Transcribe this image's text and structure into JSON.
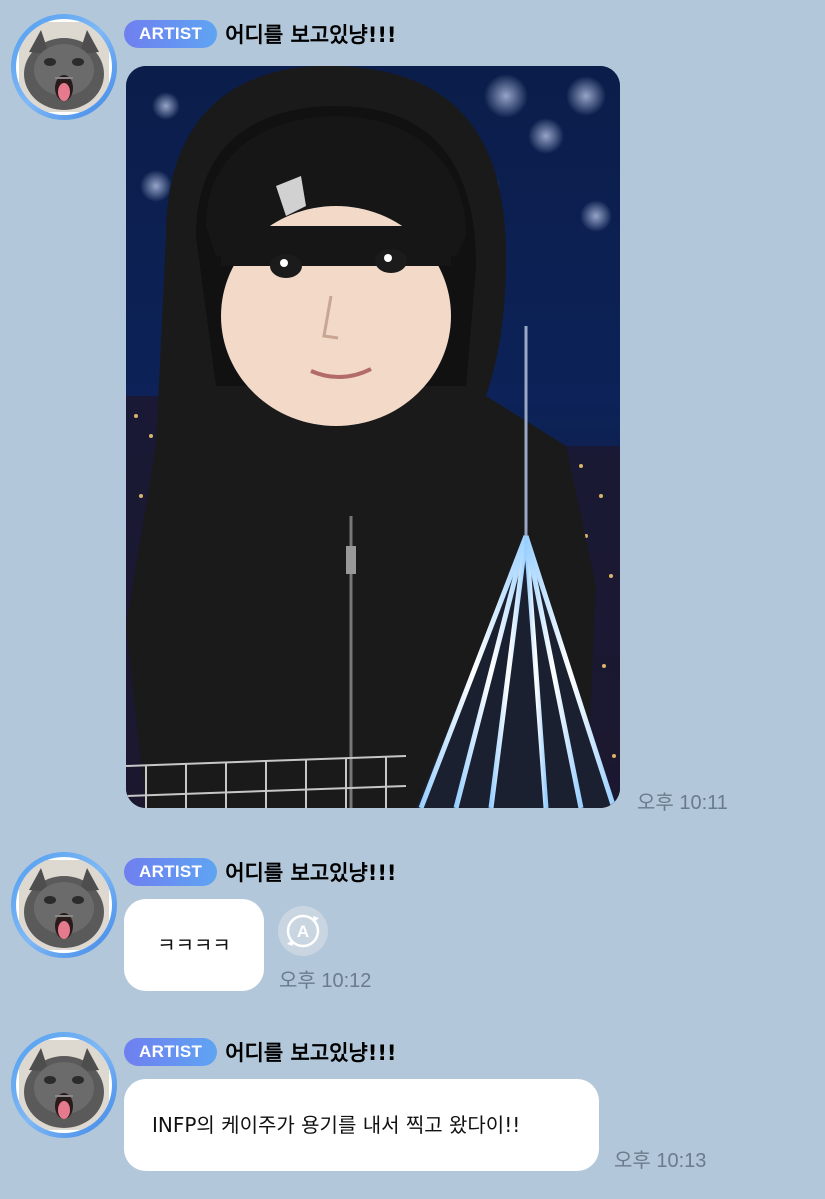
{
  "messages": [
    {
      "badge": "ARTIST",
      "sender": "어디를 보고있냥!!!",
      "type": "photo",
      "photo_desc_icon": "photo-image",
      "time": "오후 10:11"
    },
    {
      "badge": "ARTIST",
      "sender": "어디를 보고있냥!!!",
      "type": "text",
      "text": "ㅋㅋㅋㅋ",
      "translate_icon": "translate-icon",
      "translate_glyph": "A",
      "time": "오후 10:12"
    },
    {
      "badge": "ARTIST",
      "sender": "어디를 보고있냥!!!",
      "type": "text",
      "text": "INFP의 케이주가 용기를 내서 찍고 왔다이!!",
      "time": "오후 10:13"
    }
  ],
  "colors": {
    "background": "#b2c7d9",
    "badge_start": "#6f7ff0",
    "badge_end": "#5fa4f2",
    "bubble": "#ffffff",
    "time": "#6b7b8c"
  }
}
